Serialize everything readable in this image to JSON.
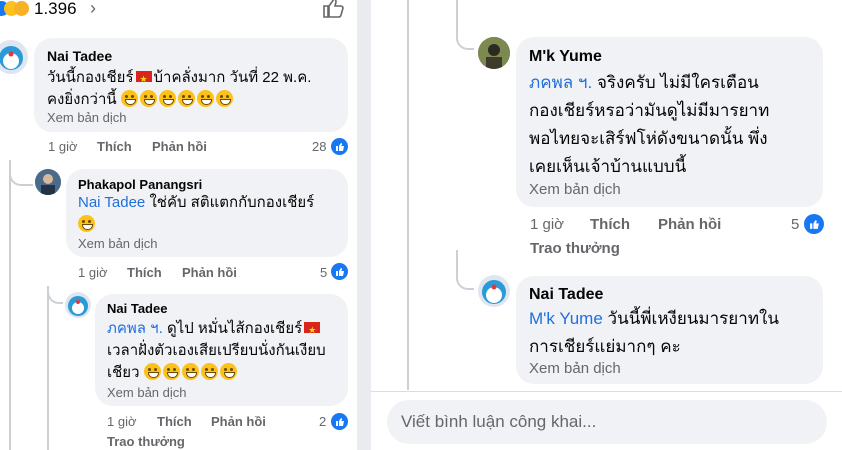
{
  "header": {
    "reaction_count": "1.396"
  },
  "comments_left": [
    {
      "author": "Nai Tadee",
      "line1": "วันนี้กองเชียร์",
      "line1b": "บ้าคลั่งมาก วันที่ 22 พ.ค.",
      "line2": "คงยิ่งกว่านี้",
      "translate": "Xem bản dịch",
      "time": "1 giờ",
      "like": "Thích",
      "reply": "Phản hồi",
      "likes": "28"
    },
    {
      "author": "Phakapol Panangsri",
      "mention": "Nai Tadee",
      "line1": "ใช่คับ สติแตกกับกองเชียร์",
      "translate": "Xem bản dịch",
      "time": "1 giờ",
      "like": "Thích",
      "reply": "Phản hồi",
      "likes": "5"
    },
    {
      "author": "Nai Tadee",
      "mention": "ภคพล ฯ.",
      "line1": "ดูไป หมั่นไส้กองเชียร์",
      "line2": "เวลาฝั่งตัวเองเสียเปรียบนั่งกันเงียบ",
      "line3": "เชียว",
      "translate": "Xem bản dịch",
      "time": "1 giờ",
      "like": "Thích",
      "reply": "Phản hồi",
      "likes": "2",
      "award": "Trao thưởng"
    }
  ],
  "comments_right": [
    {
      "author": "M'k Yume",
      "mention": "ภคพล ฯ.",
      "line1": "จริงครับ ไม่มีใครเตือน",
      "line2": "กองเชียร์หรอว่ามันดูไม่มีมารยาท",
      "line3": "พอไทยจะเสิร์ฟโห่ดังขนาดนั้น พึ่ง",
      "line4": "เคยเห็นเจ้าบ้านแบบนี้",
      "translate": "Xem bản dịch",
      "time": "1 giờ",
      "like": "Thích",
      "reply": "Phản hồi",
      "likes": "5",
      "award": "Trao thưởng"
    },
    {
      "author": "Nai Tadee",
      "mention": "M'k Yume",
      "line1": "วันนี้พี่เหงียนมารยาทใน",
      "line2": "การเชียร์แย่มากๆ คะ",
      "translate": "Xem bản dịch"
    }
  ],
  "composer": {
    "placeholder": "Viết bình luận công khai..."
  },
  "colors": {
    "bubble": "#f0f2f5",
    "mention": "#216fdb",
    "meta": "#65676b",
    "like_blue": "#1877f2"
  }
}
